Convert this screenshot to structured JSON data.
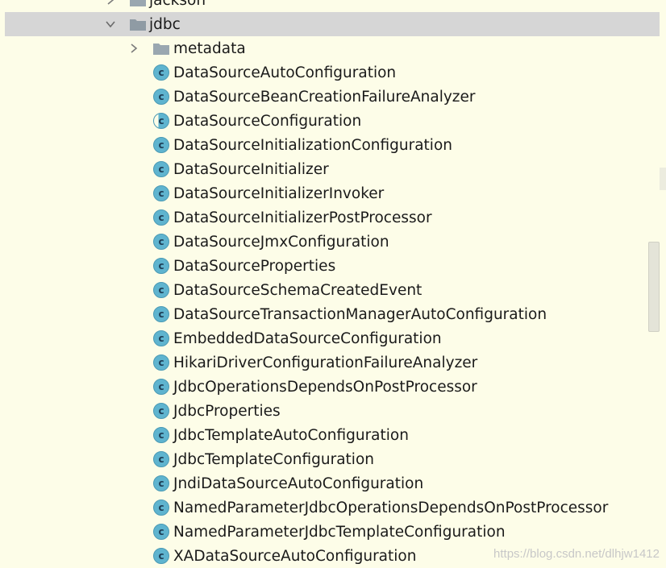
{
  "tree": {
    "parent_partial": "jackson",
    "package": "jdbc",
    "subfolder": "metadata",
    "classes": [
      "DataSourceAutoConfiguration",
      "DataSourceBeanCreationFailureAnalyzer",
      "DataSourceConfiguration",
      "DataSourceInitializationConfiguration",
      "DataSourceInitializer",
      "DataSourceInitializerInvoker",
      "DataSourceInitializerPostProcessor",
      "DataSourceJmxConfiguration",
      "DataSourceProperties",
      "DataSourceSchemaCreatedEvent",
      "DataSourceTransactionManagerAutoConfiguration",
      "EmbeddedDataSourceConfiguration",
      "HikariDriverConfigurationFailureAnalyzer",
      "JdbcOperationsDependsOnPostProcessor",
      "JdbcProperties",
      "JdbcTemplateAutoConfiguration",
      "JdbcTemplateConfiguration",
      "JndiDataSourceAutoConfiguration",
      "NamedParameterJdbcOperationsDependsOnPostProcessor",
      "NamedParameterJdbcTemplateConfiguration",
      "XADataSourceAutoConfiguration"
    ],
    "class_icon_letter": "c"
  },
  "watermark": "https://blog.csdn.net/dlhjw1412",
  "colors": {
    "background": "#fdfde8",
    "selection": "#d6d6d6",
    "class_icon": "#5fb4cf",
    "folder": "#9aa7b0"
  },
  "icons": {
    "expand": "chevron-right-icon",
    "collapse": "chevron-down-icon",
    "folder": "folder-icon",
    "class": "java-class-icon"
  }
}
